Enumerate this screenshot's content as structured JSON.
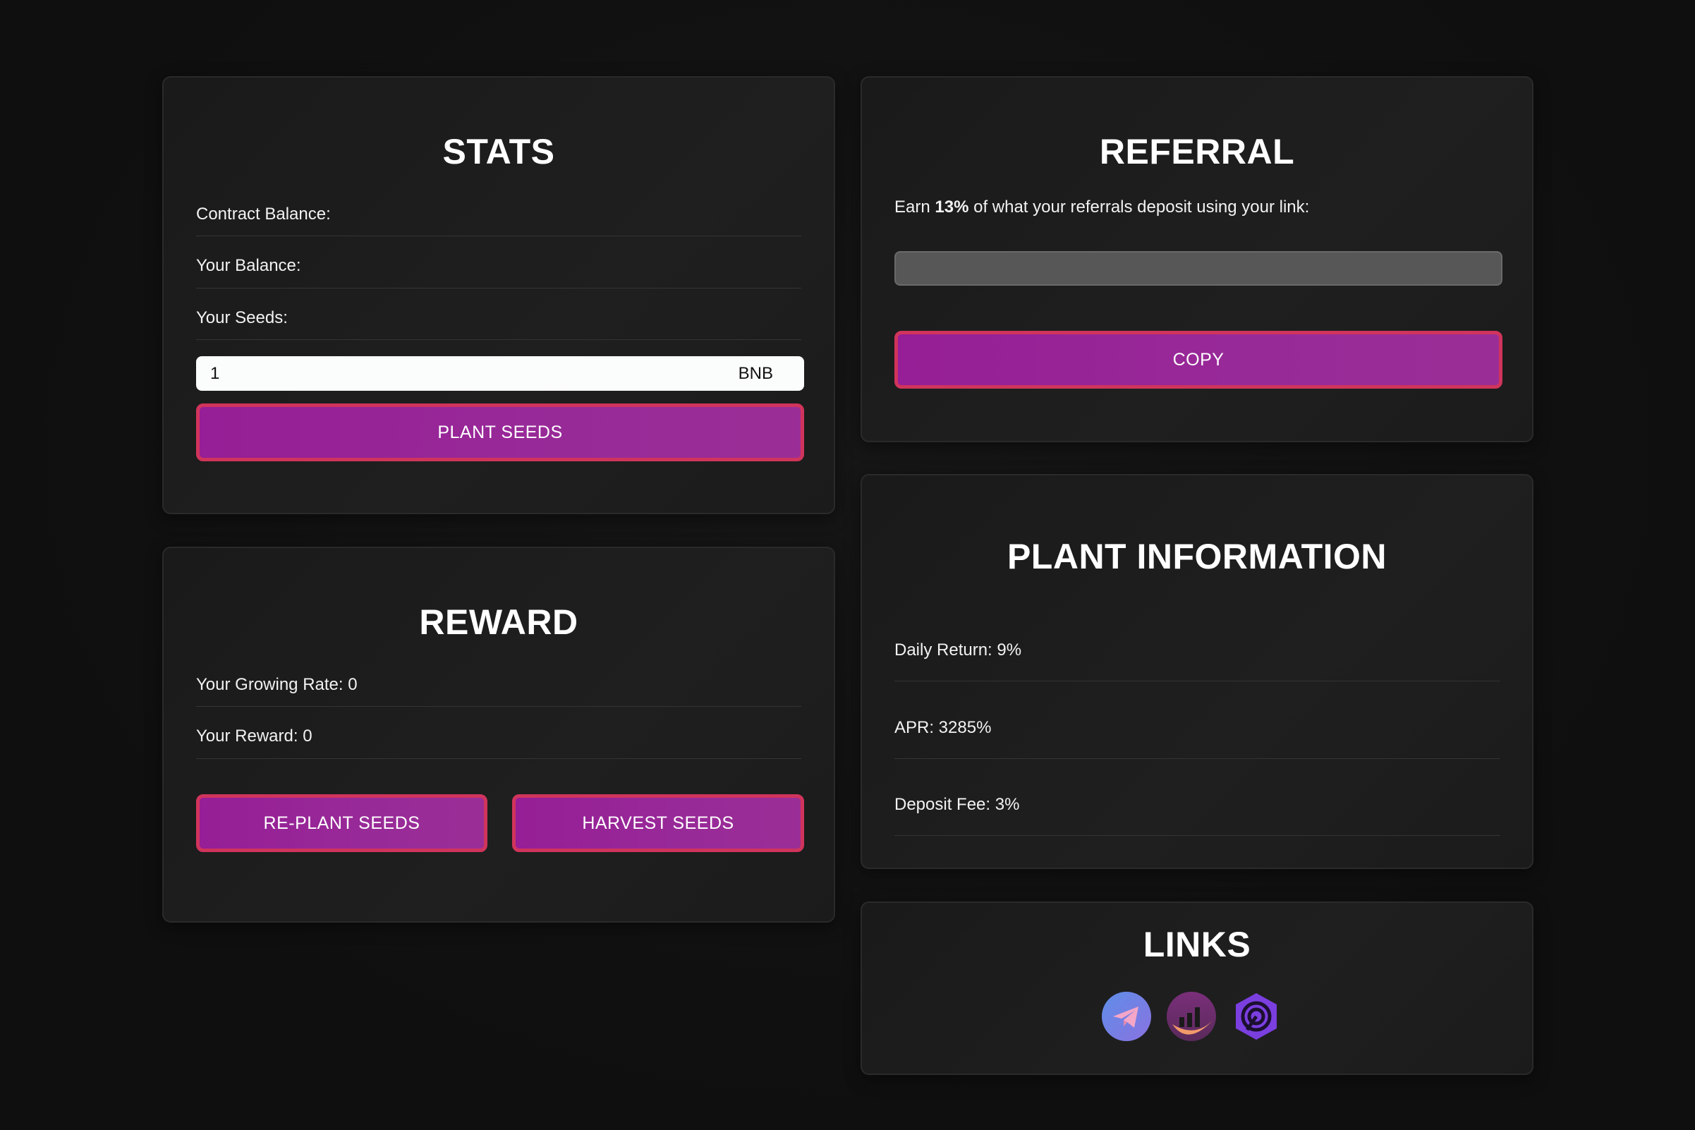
{
  "stats": {
    "title": "STATS",
    "contract_balance_label": "Contract Balance:",
    "your_balance_label": "Your Balance:",
    "your_seeds_label": "Your Seeds:",
    "amount_value": "1",
    "amount_unit": "BNB",
    "plant_button": "PLANT SEEDS"
  },
  "reward": {
    "title": "REWARD",
    "growing_rate": "Your Growing Rate: 0",
    "reward": "Your Reward: 0",
    "replant_button": "RE-PLANT SEEDS",
    "harvest_button": "HARVEST SEEDS"
  },
  "referral": {
    "title": "REFERRAL",
    "text_prefix": "Earn ",
    "text_percent": "13%",
    "text_suffix": " of what your referrals deposit using your link:",
    "link_value": "",
    "copy_button": "COPY"
  },
  "plant_info": {
    "title": "PLANT INFORMATION",
    "daily_return": "Daily Return: 9%",
    "apr": "APR: 3285%",
    "deposit_fee": "Deposit Fee: 3%"
  },
  "links": {
    "title": "LINKS",
    "icons": [
      "telegram-icon",
      "dexscreener-chart-icon",
      "hexagon-spiral-icon"
    ]
  },
  "colors": {
    "button_fill": "#961e96",
    "button_border": "#d0345c",
    "background": "#111111",
    "card": "#1d1d1d"
  }
}
